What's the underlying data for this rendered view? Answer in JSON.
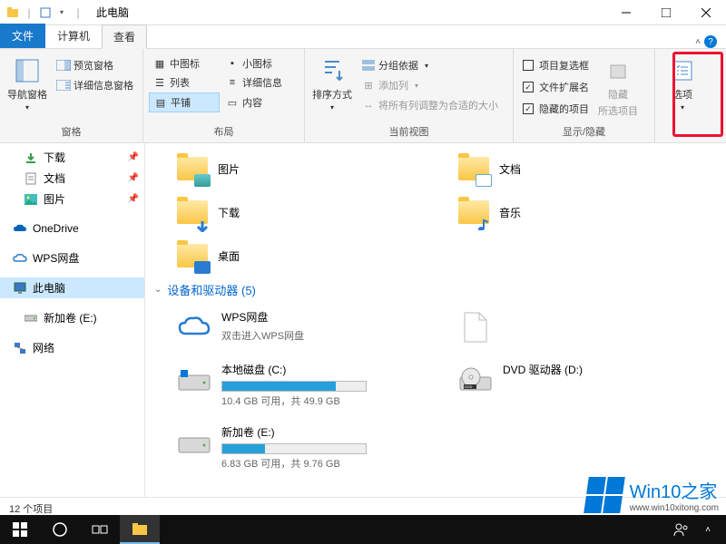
{
  "title": "此电脑",
  "tabs": {
    "file": "文件",
    "computer": "计算机",
    "view": "查看"
  },
  "ribbon": {
    "panes": {
      "label": "窗格",
      "nav": "导航窗格",
      "preview": "预览窗格",
      "details": "详细信息窗格"
    },
    "layout": {
      "label": "布局",
      "medium": "中图标",
      "small": "小图标",
      "list": "列表",
      "details": "详细信息",
      "tiles": "平铺",
      "content": "内容"
    },
    "view": {
      "label": "当前视图",
      "sort": "排序方式",
      "group": "分组依据",
      "addcol": "添加列",
      "fit": "将所有列调整为合适的大小"
    },
    "showhide": {
      "label": "显示/隐藏",
      "chk1": "项目复选框",
      "chk2": "文件扩展名",
      "chk3": "隐藏的项目",
      "hide": "隐藏",
      "hide2": "所选项目"
    },
    "options": "选项"
  },
  "nav": {
    "downloads": "下载",
    "documents": "文档",
    "pictures": "图片",
    "onedrive": "OneDrive",
    "wps": "WPS网盘",
    "thispc": "此电脑",
    "volumeE": "新加卷 (E:)",
    "network": "网络"
  },
  "folders": {
    "pictures": "图片",
    "documents": "文档",
    "downloads": "下载",
    "music": "音乐",
    "desktop": "桌面"
  },
  "devices_header": "设备和驱动器 (5)",
  "drives": {
    "wps": {
      "name": "WPS网盘",
      "sub": "双击进入WPS网盘"
    },
    "c": {
      "name": "本地磁盘 (C:)",
      "sub": "10.4 GB 可用，共 49.9 GB",
      "pct": 79
    },
    "e": {
      "name": "新加卷 (E:)",
      "sub": "6.83 GB 可用，共 9.76 GB",
      "pct": 30
    },
    "dvd": {
      "name": "DVD 驱动器 (D:)"
    }
  },
  "status": "12 个项目",
  "watermark": {
    "big": "Win10之家",
    "small": "www.win10xitong.com"
  }
}
